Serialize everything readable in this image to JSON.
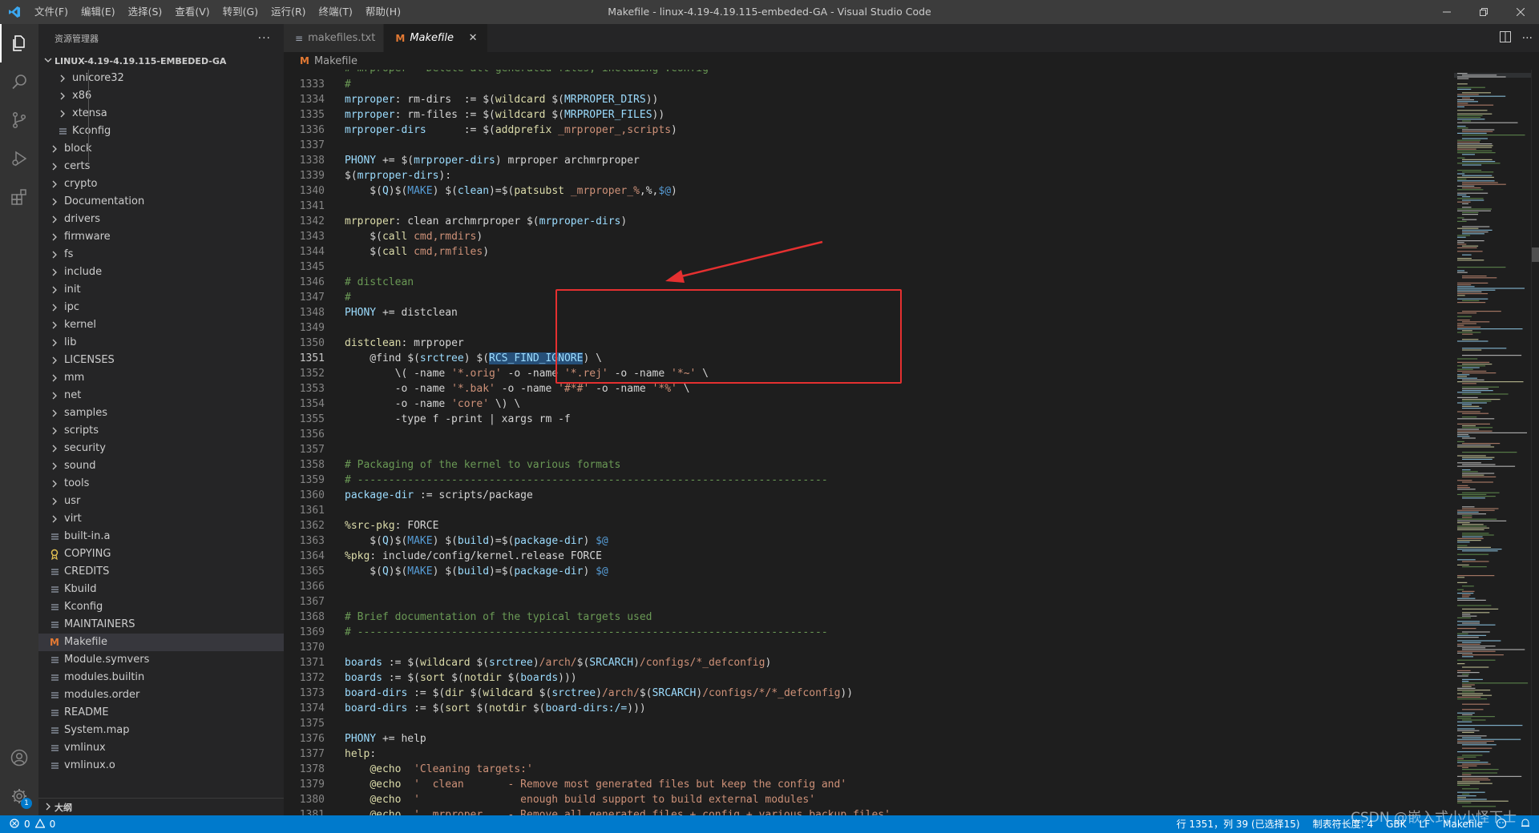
{
  "window": {
    "title": "Makefile - linux-4.19-4.19.115-embeded-GA - Visual Studio Code",
    "menu": [
      "文件(F)",
      "编辑(E)",
      "选择(S)",
      "查看(V)",
      "转到(G)",
      "运行(R)",
      "终端(T)",
      "帮助(H)"
    ]
  },
  "activitybar": {
    "icons": [
      "explorer-icon",
      "search-icon",
      "source-control-icon",
      "run-debug-icon",
      "extensions-icon"
    ],
    "bottom_icons": [
      "account-icon",
      "manage-gear-icon"
    ],
    "badge": "1"
  },
  "sidebar": {
    "header": "资源管理器",
    "more": "···",
    "root": "LINUX-4.19-4.19.115-EMBEDED-GA",
    "outline": "大纲",
    "items": [
      {
        "label": "unicore32",
        "type": "folder",
        "depth": 1
      },
      {
        "label": "x86",
        "type": "folder",
        "depth": 1
      },
      {
        "label": "xtensa",
        "type": "folder",
        "depth": 1
      },
      {
        "label": "Kconfig",
        "type": "file",
        "depth": 1
      },
      {
        "label": "block",
        "type": "folder",
        "depth": 0
      },
      {
        "label": "certs",
        "type": "folder",
        "depth": 0
      },
      {
        "label": "crypto",
        "type": "folder",
        "depth": 0
      },
      {
        "label": "Documentation",
        "type": "folder",
        "depth": 0
      },
      {
        "label": "drivers",
        "type": "folder",
        "depth": 0
      },
      {
        "label": "firmware",
        "type": "folder",
        "depth": 0
      },
      {
        "label": "fs",
        "type": "folder",
        "depth": 0
      },
      {
        "label": "include",
        "type": "folder",
        "depth": 0
      },
      {
        "label": "init",
        "type": "folder",
        "depth": 0
      },
      {
        "label": "ipc",
        "type": "folder",
        "depth": 0
      },
      {
        "label": "kernel",
        "type": "folder",
        "depth": 0
      },
      {
        "label": "lib",
        "type": "folder",
        "depth": 0
      },
      {
        "label": "LICENSES",
        "type": "folder",
        "depth": 0
      },
      {
        "label": "mm",
        "type": "folder",
        "depth": 0
      },
      {
        "label": "net",
        "type": "folder",
        "depth": 0
      },
      {
        "label": "samples",
        "type": "folder",
        "depth": 0
      },
      {
        "label": "scripts",
        "type": "folder",
        "depth": 0
      },
      {
        "label": "security",
        "type": "folder",
        "depth": 0
      },
      {
        "label": "sound",
        "type": "folder",
        "depth": 0
      },
      {
        "label": "tools",
        "type": "folder",
        "depth": 0
      },
      {
        "label": "usr",
        "type": "folder",
        "depth": 0
      },
      {
        "label": "virt",
        "type": "folder",
        "depth": 0
      },
      {
        "label": "built-in.a",
        "type": "file",
        "depth": 0
      },
      {
        "label": "COPYING",
        "type": "license",
        "depth": 0
      },
      {
        "label": "CREDITS",
        "type": "file",
        "depth": 0
      },
      {
        "label": "Kbuild",
        "type": "file",
        "depth": 0
      },
      {
        "label": "Kconfig",
        "type": "file",
        "depth": 0
      },
      {
        "label": "MAINTAINERS",
        "type": "file",
        "depth": 0
      },
      {
        "label": "Makefile",
        "type": "makefile",
        "depth": 0,
        "selected": true
      },
      {
        "label": "Module.symvers",
        "type": "file",
        "depth": 0
      },
      {
        "label": "modules.builtin",
        "type": "file",
        "depth": 0
      },
      {
        "label": "modules.order",
        "type": "file",
        "depth": 0
      },
      {
        "label": "README",
        "type": "file",
        "depth": 0
      },
      {
        "label": "System.map",
        "type": "file",
        "depth": 0
      },
      {
        "label": "vmlinux",
        "type": "file",
        "depth": 0
      },
      {
        "label": "vmlinux.o",
        "type": "file",
        "depth": 0
      }
    ]
  },
  "tabs": [
    {
      "label": "makefiles.txt",
      "active": false,
      "icon": "≡"
    },
    {
      "label": "Makefile",
      "active": true,
      "icon": "M"
    }
  ],
  "breadcrumb": "Makefile",
  "code": {
    "current_line": 1351,
    "lines": [
      {
        "n": 1333,
        "tokens": [
          [
            "cm",
            "#"
          ]
        ]
      },
      {
        "n": 1334,
        "tokens": [
          [
            "cv",
            "mrproper"
          ],
          [
            "ct",
            ": rm-dirs  := "
          ],
          [
            "ct",
            "$("
          ],
          [
            "cf",
            "wildcard"
          ],
          [
            "ct",
            " $("
          ],
          [
            "cv",
            "MRPROPER_DIRS"
          ],
          [
            "ct",
            "))"
          ]
        ]
      },
      {
        "n": 1335,
        "tokens": [
          [
            "cv",
            "mrproper"
          ],
          [
            "ct",
            ": rm-files := "
          ],
          [
            "ct",
            "$("
          ],
          [
            "cf",
            "wildcard"
          ],
          [
            "ct",
            " $("
          ],
          [
            "cv",
            "MRPROPER_FILES"
          ],
          [
            "ct",
            "))"
          ]
        ]
      },
      {
        "n": 1336,
        "tokens": [
          [
            "cv",
            "mrproper-dirs"
          ],
          [
            "ct",
            "      := "
          ],
          [
            "ct",
            "$("
          ],
          [
            "cf",
            "addprefix"
          ],
          [
            "ct",
            " "
          ],
          [
            "cs",
            "_mrproper_,scripts"
          ],
          [
            "ct",
            ")"
          ]
        ]
      },
      {
        "n": 1337,
        "tokens": []
      },
      {
        "n": 1338,
        "tokens": [
          [
            "cv",
            "PHONY"
          ],
          [
            "ct",
            " += $("
          ],
          [
            "cv",
            "mrproper-dirs"
          ],
          [
            "ct",
            ") mrproper archmrproper"
          ]
        ]
      },
      {
        "n": 1339,
        "tokens": [
          [
            "ct",
            "$("
          ],
          [
            "cv",
            "mrproper-dirs"
          ],
          [
            "ct",
            "):"
          ]
        ]
      },
      {
        "n": 1340,
        "tokens": [
          [
            "ct",
            "    $("
          ],
          [
            "cv",
            "Q"
          ],
          [
            "ct",
            ")$("
          ],
          [
            "ck",
            "MAKE"
          ],
          [
            "ct",
            ") $("
          ],
          [
            "cv",
            "clean"
          ],
          [
            "ct",
            ")=$("
          ],
          [
            "cf",
            "patsubst"
          ],
          [
            "ct",
            " "
          ],
          [
            "cs",
            "_mrproper_%"
          ],
          [
            "ct",
            ",%,"
          ],
          [
            "ck",
            "$@"
          ],
          [
            "ct",
            ")"
          ]
        ]
      },
      {
        "n": 1341,
        "tokens": []
      },
      {
        "n": 1342,
        "tokens": [
          [
            "cf",
            "mrproper"
          ],
          [
            "ct",
            ": clean archmrproper $("
          ],
          [
            "cv",
            "mrproper-dirs"
          ],
          [
            "ct",
            ")"
          ]
        ]
      },
      {
        "n": 1343,
        "tokens": [
          [
            "ct",
            "    $("
          ],
          [
            "cf",
            "call"
          ],
          [
            "cs",
            " cmd,rmdirs"
          ],
          [
            "ct",
            ")"
          ]
        ]
      },
      {
        "n": 1344,
        "tokens": [
          [
            "ct",
            "    $("
          ],
          [
            "cf",
            "call"
          ],
          [
            "cs",
            " cmd,rmfiles"
          ],
          [
            "ct",
            ")"
          ]
        ]
      },
      {
        "n": 1345,
        "tokens": []
      },
      {
        "n": 1346,
        "tokens": [
          [
            "cm",
            "# distclean"
          ]
        ]
      },
      {
        "n": 1347,
        "tokens": [
          [
            "cm",
            "#"
          ]
        ]
      },
      {
        "n": 1348,
        "tokens": [
          [
            "cv",
            "PHONY"
          ],
          [
            "ct",
            " += distclean"
          ]
        ]
      },
      {
        "n": 1349,
        "tokens": []
      },
      {
        "n": 1350,
        "tokens": [
          [
            "cf",
            "distclean"
          ],
          [
            "ct",
            ": mrproper"
          ]
        ]
      },
      {
        "n": 1351,
        "tokens": [
          [
            "ct",
            "    @find $("
          ],
          [
            "cv",
            "srctree"
          ],
          [
            "ct",
            ") $("
          ],
          [
            "hl",
            "RCS_FIND_IGNORE"
          ],
          [
            "ct",
            ") \\"
          ]
        ]
      },
      {
        "n": 1352,
        "tokens": [
          [
            "ct",
            "        \\( -name "
          ],
          [
            "cs",
            "'*.orig'"
          ],
          [
            "ct",
            " -o -name "
          ],
          [
            "cs",
            "'*.rej'"
          ],
          [
            "ct",
            " -o -name "
          ],
          [
            "cs",
            "'*~'"
          ],
          [
            "ct",
            " \\"
          ]
        ]
      },
      {
        "n": 1353,
        "tokens": [
          [
            "ct",
            "        -o -name "
          ],
          [
            "cs",
            "'*.bak'"
          ],
          [
            "ct",
            " -o -name "
          ],
          [
            "cs",
            "'#*#'"
          ],
          [
            "ct",
            " -o -name "
          ],
          [
            "cs",
            "'*%'"
          ],
          [
            "ct",
            " \\"
          ]
        ]
      },
      {
        "n": 1354,
        "tokens": [
          [
            "ct",
            "        -o -name "
          ],
          [
            "cs",
            "'core'"
          ],
          [
            "ct",
            " \\) \\"
          ]
        ]
      },
      {
        "n": 1355,
        "tokens": [
          [
            "ct",
            "        -type f -print | xargs rm -f"
          ]
        ]
      },
      {
        "n": 1356,
        "tokens": []
      },
      {
        "n": 1357,
        "tokens": []
      },
      {
        "n": 1358,
        "tokens": [
          [
            "cm",
            "# Packaging of the kernel to various formats"
          ]
        ]
      },
      {
        "n": 1359,
        "tokens": [
          [
            "cm",
            "# ---------------------------------------------------------------------------"
          ]
        ]
      },
      {
        "n": 1360,
        "tokens": [
          [
            "cv",
            "package-dir"
          ],
          [
            "ct",
            " := scripts/package"
          ]
        ]
      },
      {
        "n": 1361,
        "tokens": []
      },
      {
        "n": 1362,
        "tokens": [
          [
            "cf",
            "%src-pkg"
          ],
          [
            "ct",
            ": FORCE"
          ]
        ]
      },
      {
        "n": 1363,
        "tokens": [
          [
            "ct",
            "    $("
          ],
          [
            "cv",
            "Q"
          ],
          [
            "ct",
            ")$("
          ],
          [
            "ck",
            "MAKE"
          ],
          [
            "ct",
            ") $("
          ],
          [
            "cv",
            "build"
          ],
          [
            "ct",
            ")=$("
          ],
          [
            "cv",
            "package-dir"
          ],
          [
            "ct",
            ") "
          ],
          [
            "ck",
            "$@"
          ]
        ]
      },
      {
        "n": 1364,
        "tokens": [
          [
            "cf",
            "%pkg"
          ],
          [
            "ct",
            ": include/config/kernel.release FORCE"
          ]
        ]
      },
      {
        "n": 1365,
        "tokens": [
          [
            "ct",
            "    $("
          ],
          [
            "cv",
            "Q"
          ],
          [
            "ct",
            ")$("
          ],
          [
            "ck",
            "MAKE"
          ],
          [
            "ct",
            ") $("
          ],
          [
            "cv",
            "build"
          ],
          [
            "ct",
            ")=$("
          ],
          [
            "cv",
            "package-dir"
          ],
          [
            "ct",
            ") "
          ],
          [
            "ck",
            "$@"
          ]
        ]
      },
      {
        "n": 1366,
        "tokens": []
      },
      {
        "n": 1367,
        "tokens": []
      },
      {
        "n": 1368,
        "tokens": [
          [
            "cm",
            "# Brief documentation of the typical targets used"
          ]
        ]
      },
      {
        "n": 1369,
        "tokens": [
          [
            "cm",
            "# ---------------------------------------------------------------------------"
          ]
        ]
      },
      {
        "n": 1370,
        "tokens": []
      },
      {
        "n": 1371,
        "tokens": [
          [
            "cv",
            "boards"
          ],
          [
            "ct",
            " := $("
          ],
          [
            "cf",
            "wildcard"
          ],
          [
            "ct",
            " $("
          ],
          [
            "cv",
            "srctree"
          ],
          [
            "ct",
            ")"
          ],
          [
            "cs",
            "/arch/"
          ],
          [
            "ct",
            "$("
          ],
          [
            "cv",
            "SRCARCH"
          ],
          [
            "ct",
            ")"
          ],
          [
            "cs",
            "/configs/*_defconfig"
          ],
          [
            "ct",
            ")"
          ]
        ]
      },
      {
        "n": 1372,
        "tokens": [
          [
            "cv",
            "boards"
          ],
          [
            "ct",
            " := $("
          ],
          [
            "cf",
            "sort"
          ],
          [
            "ct",
            " $("
          ],
          [
            "cf",
            "notdir"
          ],
          [
            "ct",
            " $("
          ],
          [
            "cv",
            "boards"
          ],
          [
            "ct",
            ")))"
          ]
        ]
      },
      {
        "n": 1373,
        "tokens": [
          [
            "cv",
            "board-dirs"
          ],
          [
            "ct",
            " := $("
          ],
          [
            "cf",
            "dir"
          ],
          [
            "ct",
            " $("
          ],
          [
            "cf",
            "wildcard"
          ],
          [
            "ct",
            " $("
          ],
          [
            "cv",
            "srctree"
          ],
          [
            "ct",
            ")"
          ],
          [
            "cs",
            "/arch/"
          ],
          [
            "ct",
            "$("
          ],
          [
            "cv",
            "SRCARCH"
          ],
          [
            "ct",
            ")"
          ],
          [
            "cs",
            "/configs/*/*_defconfig"
          ],
          [
            "ct",
            "))"
          ]
        ]
      },
      {
        "n": 1374,
        "tokens": [
          [
            "cv",
            "board-dirs"
          ],
          [
            "ct",
            " := $("
          ],
          [
            "cf",
            "sort"
          ],
          [
            "ct",
            " $("
          ],
          [
            "cf",
            "notdir"
          ],
          [
            "ct",
            " $("
          ],
          [
            "cv",
            "board-dirs:/="
          ],
          [
            "ct",
            ")))"
          ]
        ]
      },
      {
        "n": 1375,
        "tokens": []
      },
      {
        "n": 1376,
        "tokens": [
          [
            "cv",
            "PHONY"
          ],
          [
            "ct",
            " += help"
          ]
        ]
      },
      {
        "n": 1377,
        "tokens": [
          [
            "cf",
            "help"
          ],
          [
            "ct",
            ":"
          ]
        ]
      },
      {
        "n": 1378,
        "tokens": [
          [
            "ct",
            "    "
          ],
          [
            "cf",
            "@echo"
          ],
          [
            "ct",
            "  "
          ],
          [
            "cs",
            "'Cleaning targets:'"
          ]
        ]
      },
      {
        "n": 1379,
        "tokens": [
          [
            "ct",
            "    "
          ],
          [
            "cf",
            "@echo"
          ],
          [
            "ct",
            "  "
          ],
          [
            "cs",
            "'  clean       - Remove most generated files but keep the config and'"
          ]
        ]
      },
      {
        "n": 1380,
        "tokens": [
          [
            "ct",
            "    "
          ],
          [
            "cf",
            "@echo"
          ],
          [
            "ct",
            "  "
          ],
          [
            "cs",
            "'                enough build support to build external modules'"
          ]
        ]
      },
      {
        "n": 1381,
        "tokens": [
          [
            "ct",
            "    "
          ],
          [
            "cf",
            "@echo"
          ],
          [
            "ct",
            "  "
          ],
          [
            "cs",
            "'  mrproper    - Remove all generated files + config + various backup files'"
          ]
        ]
      }
    ],
    "partial_top_line": "# mrproper - Delete all generated files, including .config"
  },
  "statusbar": {
    "errors": "0",
    "warnings": "0",
    "position": "行 1351，列 39 (已选择15)",
    "indent": "制表符长度: 4",
    "encoding": "GBK",
    "eol": "LF",
    "language": "Makefile"
  },
  "watermark": "CSDN @嵌入式小小怪下士",
  "colors": {
    "accent": "#007acc",
    "annotation": "#e53030"
  }
}
